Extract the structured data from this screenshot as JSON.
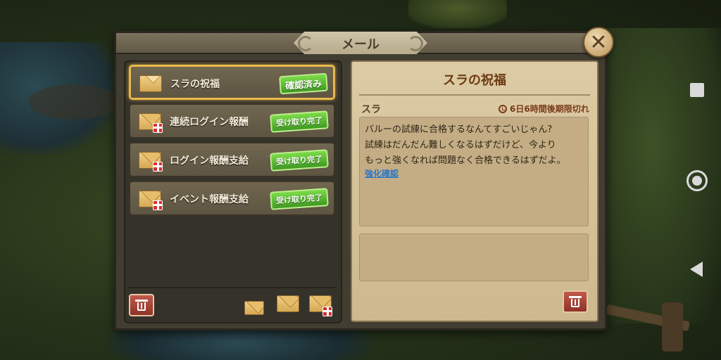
{
  "window": {
    "title": "メール"
  },
  "mail_list": [
    {
      "label": "スラの祝福",
      "badge": "確認済み",
      "selected": true,
      "has_gift": false
    },
    {
      "label": "連続ログイン報酬",
      "badge": "受け取り完了",
      "selected": false,
      "has_gift": true
    },
    {
      "label": "ログイン報酬支給",
      "badge": "受け取り完了",
      "selected": false,
      "has_gift": true
    },
    {
      "label": "イベント報酬支給",
      "badge": "受け取り完了",
      "selected": false,
      "has_gift": true
    }
  ],
  "detail": {
    "title": "スラの祝福",
    "sender": "スラ",
    "expiry": "6日6時間後期限切れ",
    "message_lines": [
      "バルーの試練に合格するなんてすごいじゃん?",
      "試練はだんだん難しくなるはずだけど、今より",
      "もっと強くなれば問題なく合格できるはずだよ。"
    ],
    "link": "強化確認"
  },
  "icons": {
    "close": "close-icon",
    "trash": "trash-icon",
    "envelope": "envelope-icon",
    "gift": "gift-icon",
    "clock": "clock-icon"
  },
  "colors": {
    "badge_green": "#4fb52c",
    "selected_border": "#e8b84a",
    "title_brown": "#6b3b12",
    "link_blue": "#2a78c8",
    "trash_red": "#a8443a"
  }
}
